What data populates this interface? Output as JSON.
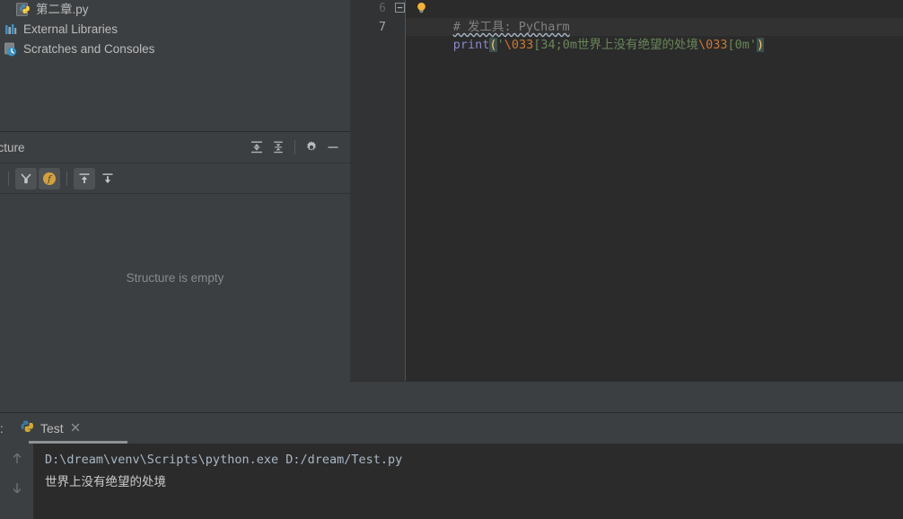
{
  "app": {
    "theme": "darcula",
    "colors": {
      "editor_bg": "#2b2b2b",
      "panel_bg": "#3c3f41",
      "gutter_bg": "#313335",
      "text": "#bbbbbb",
      "string_green": "#6a8759",
      "escape_orange": "#cc7832",
      "function_blue": "#8888c6",
      "brace_yellow": "#ffc66d",
      "comment_gray": "#808080",
      "muted_text": "#868a8c"
    }
  },
  "project_tree": {
    "items": [
      {
        "label": "第二章.py",
        "icon": "python-file-icon",
        "indent": 1
      },
      {
        "label": "External Libraries",
        "icon": "external-libraries-icon",
        "indent": 0
      },
      {
        "label": "Scratches and Consoles",
        "icon": "scratches-icon",
        "indent": 0
      }
    ]
  },
  "structure": {
    "title": "ucture",
    "empty_message": "Structure is empty",
    "header_actions": [
      {
        "name": "expand-all-icon",
        "tooltip": "Expand All"
      },
      {
        "name": "collapse-all-icon",
        "tooltip": "Collapse All"
      },
      {
        "name": "gear-icon",
        "tooltip": "Settings"
      },
      {
        "name": "minimize-icon",
        "tooltip": "Hide"
      }
    ],
    "toolbar_buttons": [
      {
        "name": "sort-by-visibility-icon",
        "pressed": true
      },
      {
        "name": "show-fields-icon",
        "pressed": true
      },
      {
        "name": "show-inherited-icon",
        "pressed": true
      },
      {
        "name": "show-imported-icon",
        "pressed": false
      }
    ]
  },
  "editor": {
    "lines": [
      {
        "number": "6",
        "current": false,
        "tokens": [
          {
            "text": "# 发工具: PyCharm",
            "type": "comment"
          }
        ]
      },
      {
        "number": "7",
        "current": true,
        "tokens": [
          {
            "text": "print",
            "type": "function"
          },
          {
            "text": "(",
            "type": "paren-highlight"
          },
          {
            "text": "'",
            "type": "string"
          },
          {
            "text": "\\033",
            "type": "escape"
          },
          {
            "text": "[34;0m世界上没有绝望的处境",
            "type": "string"
          },
          {
            "text": "\\033",
            "type": "escape"
          },
          {
            "text": "[0m'",
            "type": "string"
          },
          {
            "text": ")",
            "type": "paren-highlight"
          }
        ]
      }
    ],
    "fold_marker": "collapse-fold-icon",
    "inspection_icon": "lightbulb-icon"
  },
  "run_panel": {
    "prefix": ":",
    "tab": {
      "label": "Test",
      "icon": "python-run-icon",
      "close_icon": "close-icon",
      "active": true
    },
    "sidebar_buttons": [
      {
        "name": "previous-occurrence-icon"
      },
      {
        "name": "next-occurrence-icon"
      }
    ],
    "console": {
      "command": "D:\\dream\\venv\\Scripts\\python.exe D:/dream/Test.py",
      "output": "世界上没有绝望的处境"
    }
  }
}
